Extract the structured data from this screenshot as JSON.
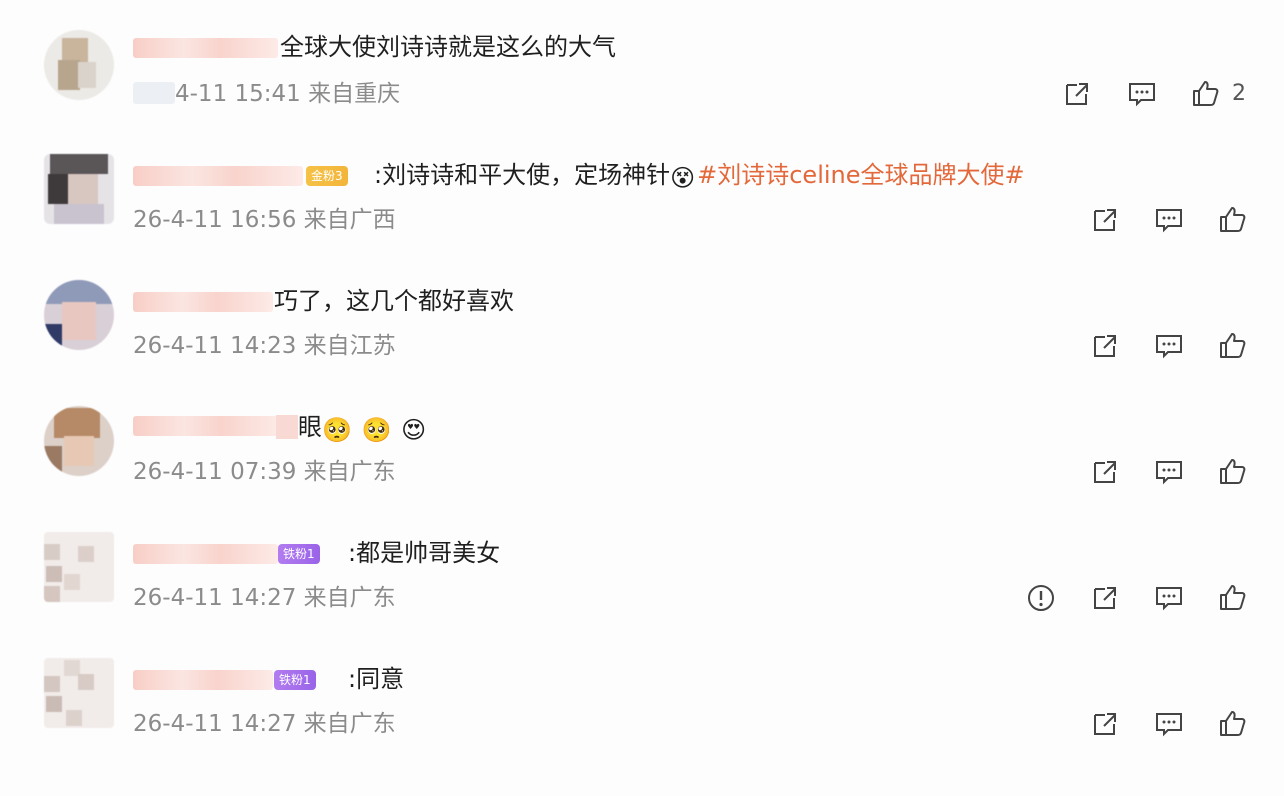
{
  "comments": [
    {
      "name_suffix": "",
      "badge": "",
      "text": "全球大使刘诗诗就是这么的大气",
      "hashtag": "",
      "emojis": [],
      "time": "4-11 15:41",
      "location": "来自重庆",
      "likes": "2",
      "report": false
    },
    {
      "badge": "金粉3",
      "text": ":刘诗诗和平大使，定场神针",
      "hashtag": "#刘诗诗celine全球品牌大使#",
      "emojis": [
        "😵"
      ],
      "time": "26-4-11 16:56",
      "location": "来自广西",
      "likes": "",
      "report": false
    },
    {
      "badge": "",
      "text": "巧了，这几个都好喜欢",
      "hashtag": "",
      "emojis": [],
      "time": "26-4-11 14:23",
      "location": "来自江苏",
      "likes": "",
      "report": false
    },
    {
      "badge": "",
      "text": "眼",
      "hashtag": "",
      "emojis": [
        "🥺",
        "🥺",
        "😍"
      ],
      "time": "26-4-11 07:39",
      "location": "来自广东",
      "likes": "",
      "report": false
    },
    {
      "badge": "铁粉1",
      "text": ":都是帅哥美女",
      "hashtag": "",
      "emojis": [],
      "time": "26-4-11 14:27",
      "location": "来自广东",
      "likes": "",
      "report": true
    },
    {
      "badge": "铁粉1",
      "text": ":同意",
      "hashtag": "",
      "emojis": [],
      "time": "26-4-11 14:27",
      "location": "来自广东",
      "likes": "",
      "report": false
    }
  ],
  "icons": {
    "share": "share-icon",
    "comment": "comment-icon",
    "like": "thumbs-up-icon",
    "report": "report-icon"
  },
  "colors": {
    "hashtag": "#e3683a",
    "meta": "#8b8b8b",
    "badge_gold": "#f2b53a",
    "badge_purple": "#9a63e8"
  }
}
